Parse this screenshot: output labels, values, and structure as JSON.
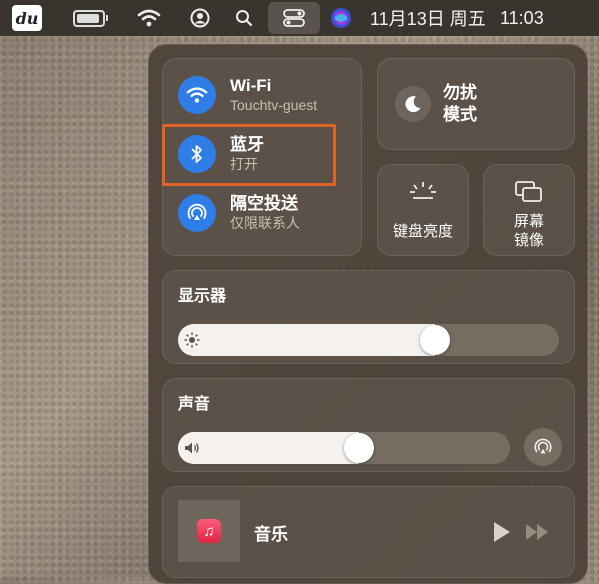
{
  "menubar": {
    "app_logo_text": "du",
    "date": "11月13日 周五",
    "time": "11:03",
    "icons": [
      "battery-icon",
      "wifi-icon",
      "user-icon",
      "search-icon",
      "control-center-icon",
      "siri-icon"
    ]
  },
  "control_center": {
    "wifi": {
      "label": "Wi-Fi",
      "status": "Touchtv-guest"
    },
    "bluetooth": {
      "label": "蓝牙",
      "status": "打开"
    },
    "airdrop": {
      "label": "隔空投送",
      "status": "仅限联系人"
    },
    "dnd": {
      "label": "勿扰模式"
    },
    "keyboard_brightness": {
      "label": "键盘亮度"
    },
    "screen_mirroring": {
      "label": "屏幕镜像"
    },
    "display": {
      "title": "显示器",
      "level": 0.69
    },
    "sound": {
      "title": "声音",
      "level": 0.55
    },
    "now_playing": {
      "app": "音乐"
    },
    "colors": {
      "accent": "#2f7de6",
      "highlight": "#e0632a"
    }
  }
}
